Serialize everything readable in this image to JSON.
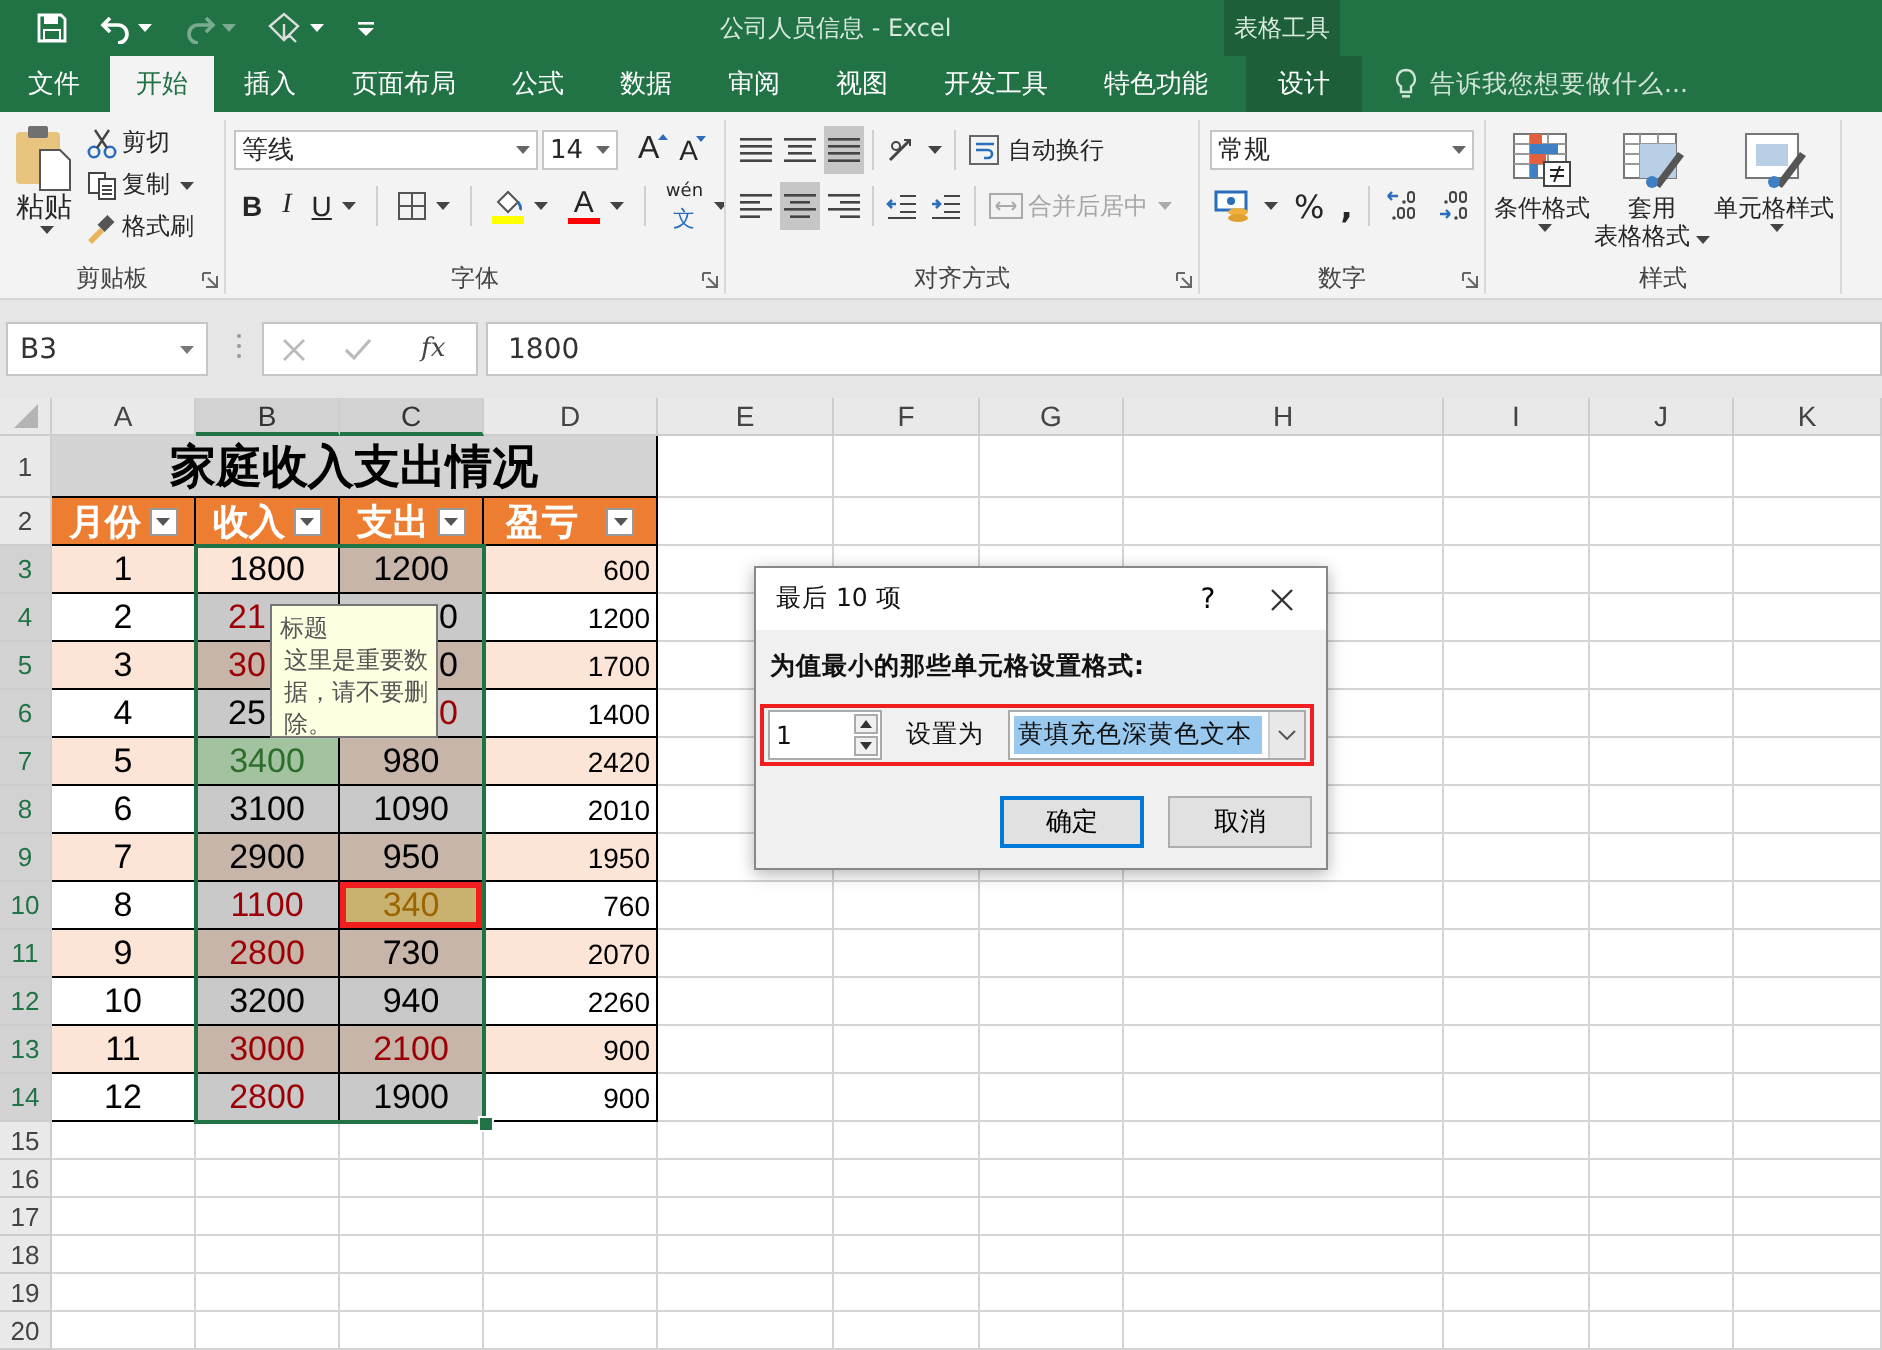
{
  "title_bar": {
    "title": "公司人员信息 - Excel",
    "context_label": "表格工具",
    "quick_access": [
      {
        "kind": "save",
        "disabled": false,
        "dropdown": false
      },
      {
        "kind": "undo",
        "disabled": false,
        "dropdown": true
      },
      {
        "kind": "redo",
        "disabled": true,
        "dropdown": true
      },
      {
        "kind": "touch",
        "disabled": false,
        "dropdown": true
      },
      {
        "kind": "customize",
        "disabled": false,
        "dropdown": false
      }
    ]
  },
  "tabs": [
    {
      "label": "文件",
      "selected": false,
      "contextual": false
    },
    {
      "label": "开始",
      "selected": true,
      "contextual": false
    },
    {
      "label": "插入",
      "selected": false,
      "contextual": false
    },
    {
      "label": "页面布局",
      "selected": false,
      "contextual": false
    },
    {
      "label": "公式",
      "selected": false,
      "contextual": false
    },
    {
      "label": "数据",
      "selected": false,
      "contextual": false
    },
    {
      "label": "审阅",
      "selected": false,
      "contextual": false
    },
    {
      "label": "视图",
      "selected": false,
      "contextual": false
    },
    {
      "label": "开发工具",
      "selected": false,
      "contextual": false
    },
    {
      "label": "特色功能",
      "selected": false,
      "contextual": false
    },
    {
      "label": "设计",
      "selected": false,
      "contextual": true
    }
  ],
  "tell_me": "告诉我您想要做什么...",
  "ribbon": {
    "groups": [
      {
        "kind": "clipboard",
        "label": "剪贴板",
        "launcher": true,
        "paste": "粘贴",
        "items": [
          {
            "kind": "cut",
            "label": "剪切",
            "dropdown": false
          },
          {
            "kind": "copy",
            "label": "复制",
            "dropdown": true
          },
          {
            "kind": "painter",
            "label": "格式刷",
            "dropdown": false
          }
        ]
      },
      {
        "kind": "font",
        "label": "字体",
        "launcher": true,
        "font_name": "等线",
        "font_size": "14",
        "grow": "A",
        "shrink": "A",
        "format_buttons": [
          "B",
          "I",
          "U"
        ],
        "font_color": "A",
        "phonetic": "wén",
        "phonetic_char": "文"
      },
      {
        "kind": "alignment",
        "label": "对齐方式",
        "launcher": true,
        "vertical": [
          {
            "selected": false
          },
          {
            "selected": false
          },
          {
            "selected": true
          }
        ],
        "horizontal": [
          {
            "selected": false
          },
          {
            "selected": true
          },
          {
            "selected": false
          }
        ],
        "wrap": {
          "label": "自动换行",
          "disabled": false
        },
        "merge": {
          "label": "合并后居中",
          "disabled": true
        }
      },
      {
        "kind": "number",
        "label": "数字",
        "launcher": true,
        "format": "常规",
        "percent": "%",
        "comma": ","
      },
      {
        "kind": "styles",
        "label": "样式",
        "launcher": false,
        "buttons": [
          {
            "kind": "conditional",
            "lines": [
              "条件格式"
            ],
            "caret_below": true
          },
          {
            "kind": "table",
            "lines": [
              "套用",
              "表格格式"
            ],
            "caret_below": false
          },
          {
            "kind": "cell",
            "lines": [
              "单元格样式"
            ],
            "caret_below": true
          }
        ]
      }
    ]
  },
  "formula_bar": {
    "name_box": "B3",
    "function_label": "fx",
    "formula": "1800"
  },
  "sheet": {
    "columns": [
      {
        "label": "A",
        "selected": false
      },
      {
        "label": "B",
        "selected": true
      },
      {
        "label": "C",
        "selected": true
      },
      {
        "label": "D",
        "selected": false
      },
      {
        "label": "E",
        "selected": false
      },
      {
        "label": "F",
        "selected": false
      },
      {
        "label": "G",
        "selected": false
      },
      {
        "label": "H",
        "selected": false
      },
      {
        "label": "I",
        "selected": false
      },
      {
        "label": "J",
        "selected": false
      },
      {
        "label": "K",
        "selected": false
      }
    ],
    "row_numbers": [
      {
        "label": "1",
        "selected": false
      },
      {
        "label": "2",
        "selected": false
      },
      {
        "label": "3",
        "selected": true
      },
      {
        "label": "4",
        "selected": true
      },
      {
        "label": "5",
        "selected": true
      },
      {
        "label": "6",
        "selected": true
      },
      {
        "label": "7",
        "selected": true
      },
      {
        "label": "8",
        "selected": true
      },
      {
        "label": "9",
        "selected": true
      },
      {
        "label": "10",
        "selected": true
      },
      {
        "label": "11",
        "selected": true
      },
      {
        "label": "12",
        "selected": true
      },
      {
        "label": "13",
        "selected": true
      },
      {
        "label": "14",
        "selected": true
      },
      {
        "label": "15",
        "selected": false
      },
      {
        "label": "16",
        "selected": false
      },
      {
        "label": "17",
        "selected": false
      },
      {
        "label": "18",
        "selected": false
      },
      {
        "label": "19",
        "selected": false
      },
      {
        "label": "20",
        "selected": false
      }
    ],
    "title": "家庭收入支出情况",
    "headers": [
      {
        "label": "月份",
        "filter": true
      },
      {
        "label": "收入",
        "filter": true
      },
      {
        "label": "支出",
        "filter": true
      },
      {
        "label": "盈亏",
        "filter": true
      }
    ],
    "rows": [
      {
        "striped": true,
        "cells": [
          {
            "text": "1"
          },
          {
            "text": "1800",
            "kind": "plain",
            "highlighted": false
          },
          {
            "text": "1200",
            "kind": "brown",
            "highlighted": false
          },
          {
            "text": "600"
          }
        ]
      },
      {
        "striped": false,
        "cells": [
          {
            "text": "2"
          },
          {
            "text": "21",
            "kind": "greyred",
            "cut_right": true,
            "highlighted": false
          },
          {
            "text": "0",
            "kind": "grey",
            "cut_left": true,
            "highlighted": false
          },
          {
            "text": "1200"
          }
        ]
      },
      {
        "striped": true,
        "cells": [
          {
            "text": "3"
          },
          {
            "text": "30",
            "kind": "brownred",
            "cut_right": true,
            "highlighted": false
          },
          {
            "text": "0",
            "kind": "brown",
            "cut_left": true,
            "highlighted": false
          },
          {
            "text": "1700"
          }
        ]
      },
      {
        "striped": false,
        "cells": [
          {
            "text": "4"
          },
          {
            "text": "25",
            "kind": "grey",
            "cut_right": true,
            "highlighted": false
          },
          {
            "text": "0",
            "kind": "greyred",
            "cut_left": true,
            "highlighted": false
          },
          {
            "text": "1400"
          }
        ]
      },
      {
        "striped": true,
        "cells": [
          {
            "text": "5"
          },
          {
            "text": "3400",
            "kind": "green",
            "highlighted": false
          },
          {
            "text": "980",
            "kind": "brown",
            "highlighted": false
          },
          {
            "text": "2420"
          }
        ]
      },
      {
        "striped": false,
        "cells": [
          {
            "text": "6"
          },
          {
            "text": "3100",
            "kind": "grey",
            "highlighted": false
          },
          {
            "text": "1090",
            "kind": "grey",
            "highlighted": false
          },
          {
            "text": "2010"
          }
        ]
      },
      {
        "striped": true,
        "cells": [
          {
            "text": "7"
          },
          {
            "text": "2900",
            "kind": "brown",
            "highlighted": false
          },
          {
            "text": "950",
            "kind": "brown",
            "highlighted": false
          },
          {
            "text": "1950"
          }
        ]
      },
      {
        "striped": false,
        "cells": [
          {
            "text": "8"
          },
          {
            "text": "1100",
            "kind": "greyred",
            "highlighted": false
          },
          {
            "text": "340",
            "kind": "gold",
            "highlighted": true
          },
          {
            "text": "760"
          }
        ]
      },
      {
        "striped": true,
        "cells": [
          {
            "text": "9"
          },
          {
            "text": "2800",
            "kind": "brownred",
            "highlighted": false
          },
          {
            "text": "730",
            "kind": "brown",
            "highlighted": false
          },
          {
            "text": "2070"
          }
        ]
      },
      {
        "striped": false,
        "cells": [
          {
            "text": "10"
          },
          {
            "text": "3200",
            "kind": "grey",
            "highlighted": false
          },
          {
            "text": "940",
            "kind": "grey",
            "highlighted": false
          },
          {
            "text": "2260"
          }
        ]
      },
      {
        "striped": true,
        "cells": [
          {
            "text": "11"
          },
          {
            "text": "3000",
            "kind": "brownred",
            "highlighted": false
          },
          {
            "text": "2100",
            "kind": "brownred",
            "highlighted": false
          },
          {
            "text": "900"
          }
        ]
      },
      {
        "striped": false,
        "cells": [
          {
            "text": "12"
          },
          {
            "text": "2800",
            "kind": "greyred",
            "highlighted": false
          },
          {
            "text": "1900",
            "kind": "grey",
            "highlighted": false
          },
          {
            "text": "900"
          }
        ]
      }
    ],
    "tooltip": {
      "title": "标题",
      "text": "这里是重要数据，请不要删除。"
    }
  },
  "dialog": {
    "title": "最后 10 项",
    "help": "?",
    "prompt": "为值最小的那些单元格设置格式:",
    "count": "1",
    "set_label": "设置为",
    "format_value": "黄填充色深黄色文本",
    "annotated": true,
    "buttons": [
      {
        "label": "确定",
        "default": true
      },
      {
        "label": "取消",
        "default": false
      }
    ]
  }
}
